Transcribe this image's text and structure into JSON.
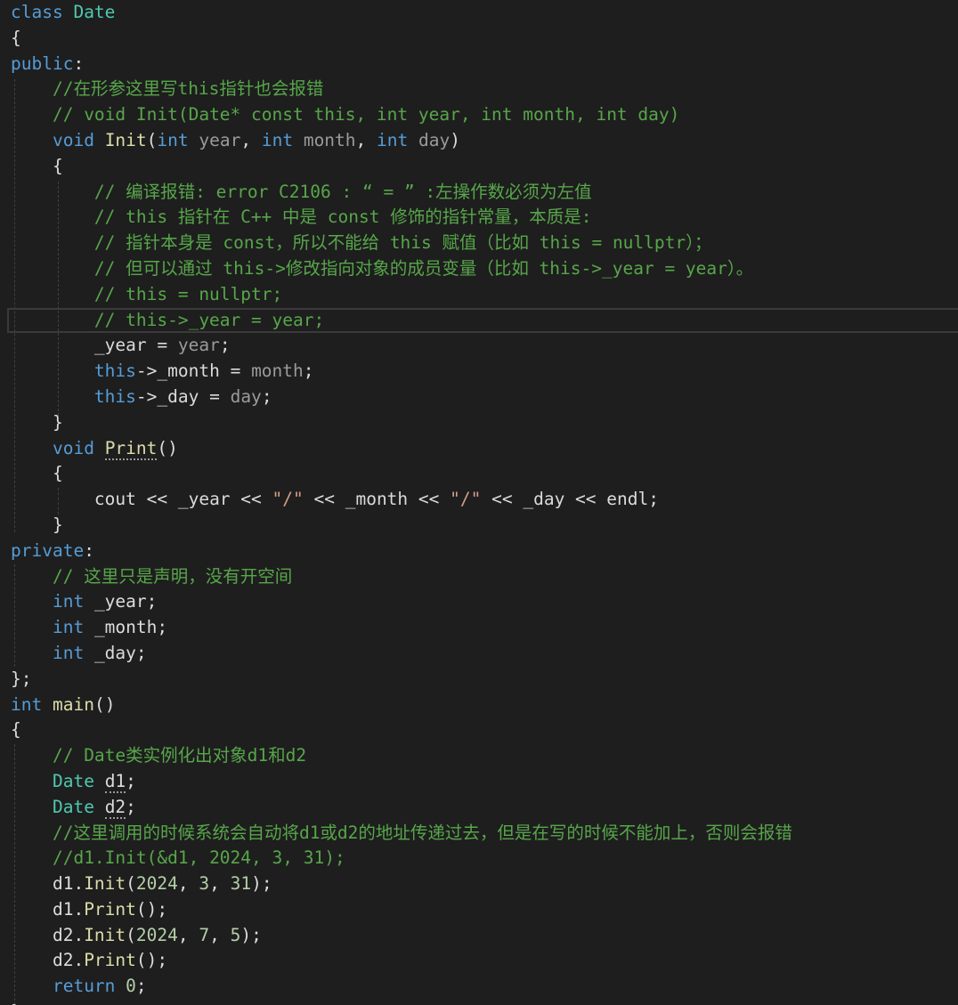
{
  "editor": {
    "language": "C++",
    "theme_colors": {
      "background": "#1e1e1e",
      "keyword": "#569cd6",
      "type": "#4ec9b0",
      "comment": "#57a64a",
      "string": "#d69d85",
      "number": "#b5cea8"
    },
    "lines": [
      "class Date",
      "{",
      "public:",
      "    //在形参这里写this指针也会报错",
      "    // void Init(Date* const this, int year, int month, int day)",
      "    void Init(int year, int month, int day)",
      "    {",
      "        // 编译报错: error C2106 : “ = ” :左操作数必须为左值",
      "        // this 指针在 C++ 中是 const 修饰的指针常量，本质是:",
      "        // 指针本身是 const，所以不能给 this 赋值（比如 this = nullptr）；",
      "        // 但可以通过 this->修改指向对象的成员变量（比如 this->_year = year）。",
      "        // this = nullptr;",
      "        // this->_year = year;",
      "        _year = year;",
      "        this->_month = month;",
      "        this->_day = day;",
      "    }",
      "    void Print()",
      "    {",
      "        cout << _year << \"/\" << _month << \"/\" << _day << endl;",
      "    }",
      "private:",
      "    // 这里只是声明，没有开空间",
      "    int _year;",
      "    int _month;",
      "    int _day;",
      "};",
      "int main()",
      "{",
      "    // Date类实例化出对象d1和d2",
      "    Date d1;",
      "    Date d2;",
      "    //这里调用的时候系统会自动将d1或d2的地址传递过去，但是在写的时候不能加上，否则会报错",
      "    //d1.Init(&d1, 2024, 3, 31);",
      "    d1.Init(2024, 3, 31);",
      "    d1.Print();",
      "    d2.Init(2024, 7, 5);",
      "    d2.Print();",
      "    return 0;",
      "}"
    ]
  }
}
